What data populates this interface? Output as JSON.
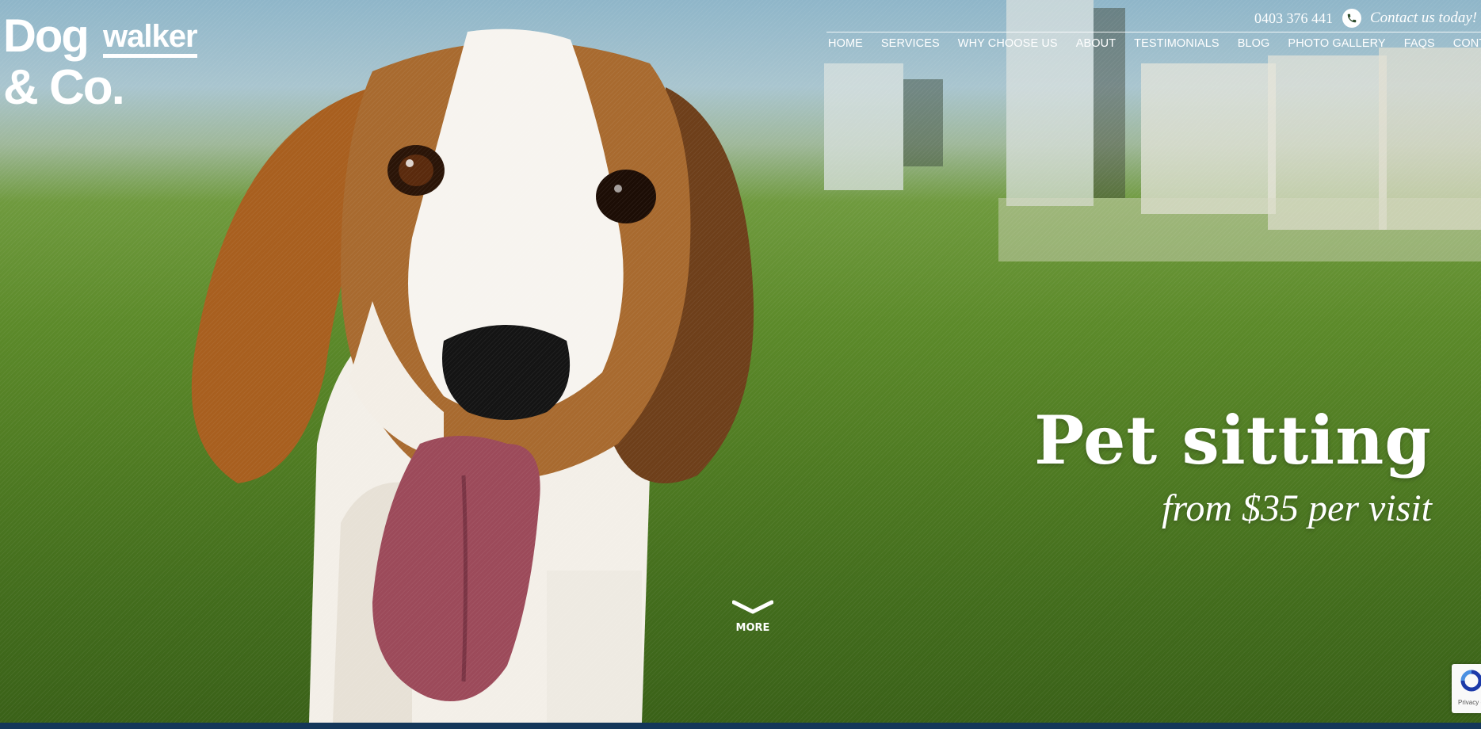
{
  "logo": {
    "line1": "Dog",
    "line1_sub": "walker",
    "line2": "& Co."
  },
  "contact": {
    "phone": "0403 376 441",
    "cta": "Contact us today!"
  },
  "nav": {
    "items": [
      {
        "label": "HOME"
      },
      {
        "label": "SERVICES"
      },
      {
        "label": "WHY CHOOSE US"
      },
      {
        "label": "ABOUT"
      },
      {
        "label": "TESTIMONIALS"
      },
      {
        "label": "BLOG"
      },
      {
        "label": "PHOTO GALLERY"
      },
      {
        "label": "FAQS"
      },
      {
        "label": "CONTACT"
      }
    ]
  },
  "hero": {
    "title": "Pet sitting",
    "subtitle": "from $35 per visit"
  },
  "more": {
    "label": "MORE"
  },
  "recaptcha": {
    "text": "Privacy -"
  },
  "colors": {
    "text": "#ffffff",
    "grass": "#5c8a2a",
    "sky": "#a9c5cf",
    "bottom_bar": "#14375a"
  }
}
